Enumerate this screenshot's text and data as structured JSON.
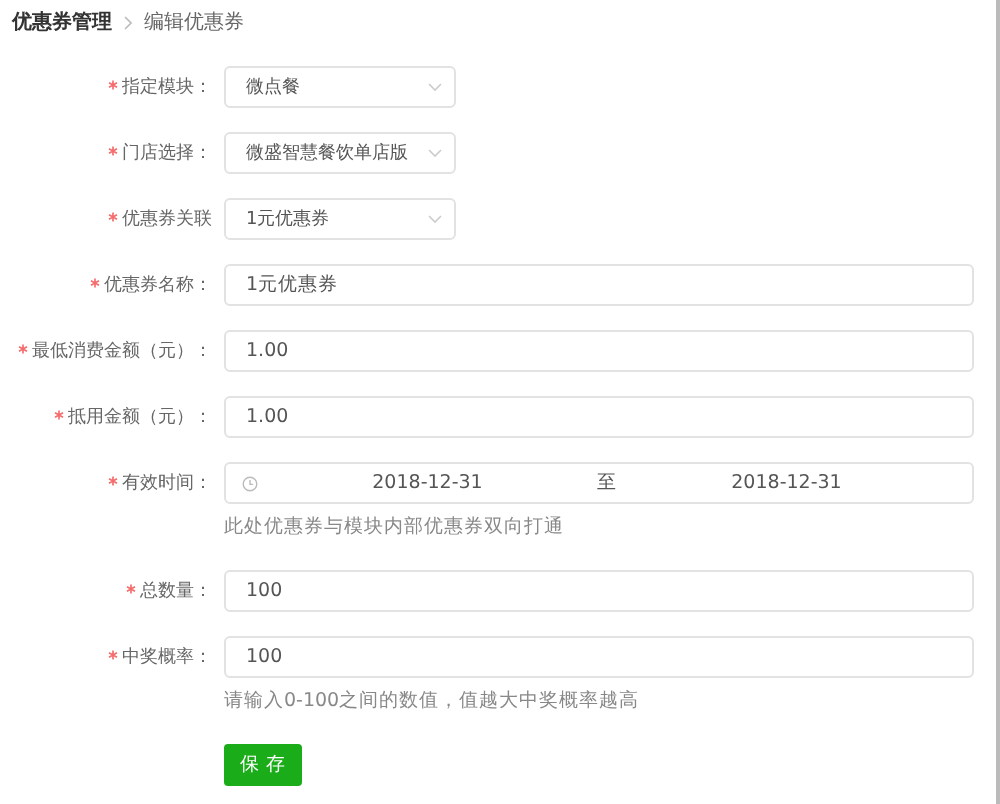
{
  "breadcrumb": {
    "parent": "优惠券管理",
    "current": "编辑优惠券"
  },
  "fields": [
    {
      "kind": "select",
      "label": "指定模块：",
      "required": true,
      "value": "微点餐"
    },
    {
      "kind": "select",
      "label": "门店选择：",
      "required": true,
      "value": "微盛智慧餐饮单店版"
    },
    {
      "kind": "select",
      "label": "优惠券关联",
      "required": true,
      "value": "1元优惠券"
    },
    {
      "kind": "input",
      "label": "优惠券名称：",
      "required": true,
      "value": "1元优惠券"
    },
    {
      "kind": "input",
      "label": "最低消费金额（元）：",
      "required": true,
      "value": "1.00"
    },
    {
      "kind": "input",
      "label": "抵用金额（元）：",
      "required": true,
      "value": "1.00"
    },
    {
      "kind": "daterange",
      "label": "有效时间：",
      "required": true,
      "start": "2018-12-31",
      "separator": "至",
      "end": "2018-12-31",
      "hint": "此处优惠券与模块内部优惠券双向打通"
    },
    {
      "kind": "input",
      "label": "总数量：",
      "required": true,
      "value": "100"
    },
    {
      "kind": "input",
      "label": "中奖概率：",
      "required": true,
      "value": "100",
      "hint": "请输入0-100之间的数值，值越大中奖概率越高"
    }
  ],
  "save_button": "保 存"
}
